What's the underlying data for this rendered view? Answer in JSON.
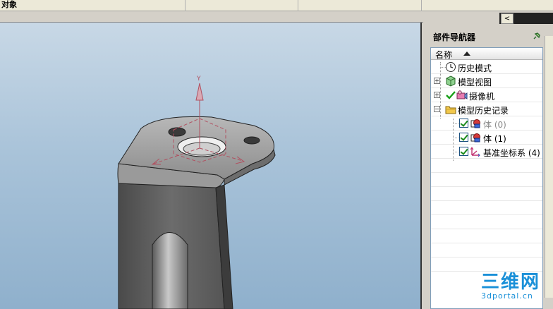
{
  "window": {
    "title": "对象"
  },
  "navigator": {
    "title": "部件导航器",
    "collapse_glyph": "<",
    "column_name": "名称",
    "items": [
      {
        "label": "历史模式",
        "icon": "clock-icon",
        "expander": "",
        "dim": false
      },
      {
        "label": "模型视图",
        "icon": "model-view-icon",
        "expander": "+",
        "dim": false
      },
      {
        "label": "摄像机",
        "icon": "camera-icon",
        "expander": "+",
        "dim": false
      },
      {
        "label": "模型历史记录",
        "icon": "folder-icon",
        "expander": "−",
        "dim": false
      },
      {
        "label": "体 (0)",
        "icon": "body-feature-icon",
        "checked": true,
        "dim": true
      },
      {
        "label": "体 (1)",
        "icon": "body-feature-icon",
        "checked": true,
        "dim": false
      },
      {
        "label": "基准坐标系 (4)",
        "icon": "datum-csys-icon",
        "checked": true,
        "dim": false
      }
    ]
  },
  "viewport": {
    "axis_label": "Y"
  },
  "watermark": {
    "main": "三维网",
    "sub": "3dportal.cn"
  },
  "colors": {
    "viewport_top": "#c8d8e6",
    "viewport_bottom": "#8fb0cc",
    "accent": "#1a90d8",
    "csys": "#b05060"
  }
}
